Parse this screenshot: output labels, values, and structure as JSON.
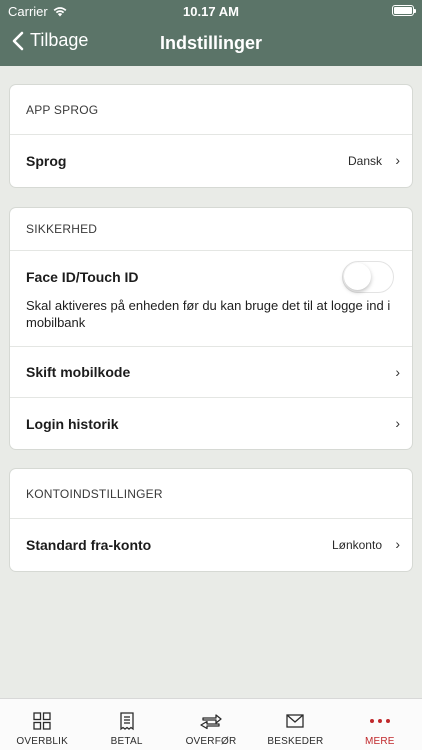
{
  "status": {
    "carrier": "Carrier",
    "time": "10.17 AM"
  },
  "nav": {
    "back_label": "Tilbage",
    "title": "Indstillinger"
  },
  "sections": {
    "app_language": {
      "header": "APP SPROG",
      "rows": [
        {
          "label": "Sprog",
          "value": "Dansk"
        }
      ]
    },
    "security": {
      "header": "SIKKERHED",
      "face_id": {
        "label": "Face ID/Touch ID",
        "description": "Skal aktiveres på enheden før du kan bruge det til at logge ind i mobilbank",
        "enabled": false
      },
      "rows": [
        {
          "label": "Skift mobilkode"
        },
        {
          "label": "Login historik"
        }
      ]
    },
    "account": {
      "header": "KONTOINDSTILLINGER",
      "rows": [
        {
          "label": "Standard fra-konto",
          "value": "Lønkonto"
        }
      ]
    }
  },
  "tabs": [
    {
      "label": "OVERBLIK",
      "icon": "grid-icon"
    },
    {
      "label": "BETAL",
      "icon": "receipt-icon"
    },
    {
      "label": "OVERFØR",
      "icon": "transfer-icon"
    },
    {
      "label": "BESKEDER",
      "icon": "envelope-icon"
    },
    {
      "label": "MERE",
      "icon": "more-dots-icon",
      "active": true
    }
  ],
  "colors": {
    "header": "#5b7468",
    "accent": "#c0282b",
    "background": "#e9ebe7"
  }
}
